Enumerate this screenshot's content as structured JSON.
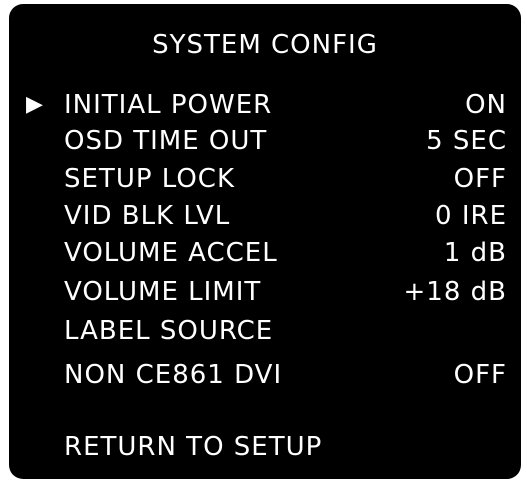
{
  "menu": {
    "title": "SYSTEM CONFIG",
    "cursor_glyph": "▶",
    "items": [
      {
        "label": "INITIAL POWER",
        "value": "ON",
        "selected": true
      },
      {
        "label": "OSD TIME OUT",
        "value": "5 SEC"
      },
      {
        "label": "SETUP LOCK",
        "value": "OFF"
      },
      {
        "label": "VID BLK LVL",
        "value": "0 IRE"
      },
      {
        "label": "VOLUME ACCEL",
        "value": "1 dB"
      },
      {
        "label": "VOLUME LIMIT",
        "value": "+18 dB"
      },
      {
        "label": "LABEL SOURCE",
        "value": ""
      },
      {
        "label": "NON CE861 DVI",
        "value": "OFF"
      }
    ],
    "return_label": "RETURN TO SETUP"
  },
  "colors": {
    "background": "#000000",
    "text": "#ffffff"
  }
}
